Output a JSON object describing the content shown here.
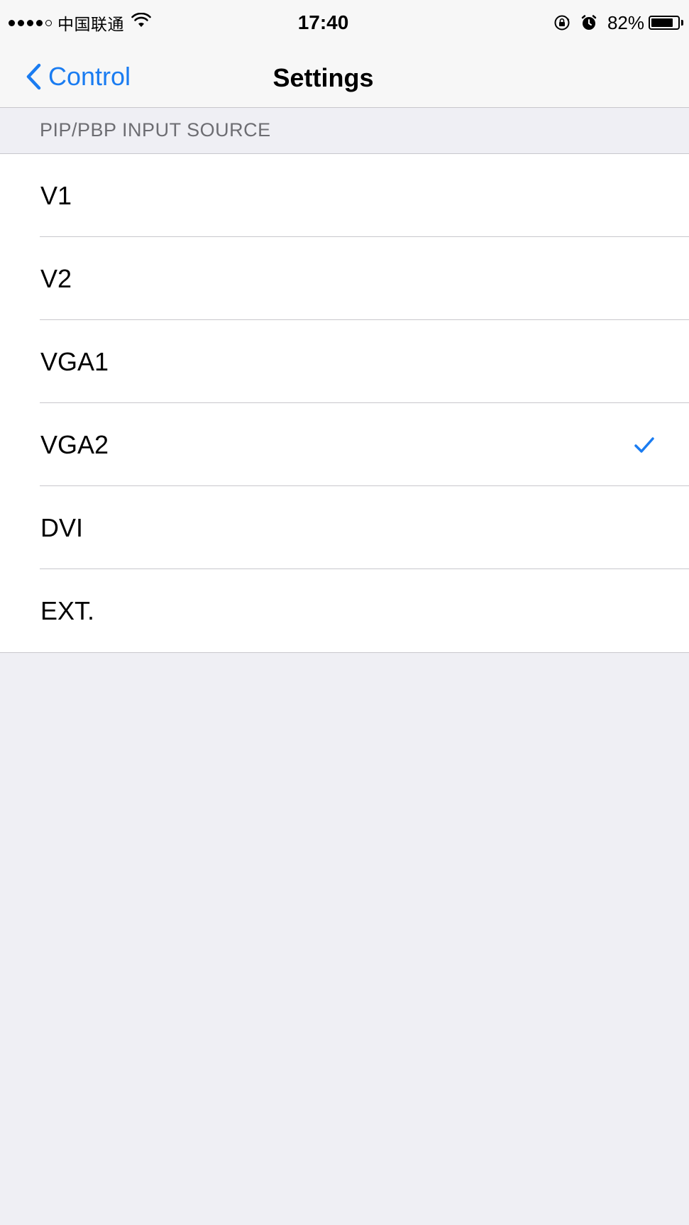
{
  "status_bar": {
    "carrier": "中国联通",
    "time": "17:40",
    "battery_percent": "82%",
    "battery_level": 0.82,
    "icons": [
      "signal-dots-icon",
      "wifi-icon",
      "rotation-lock-icon",
      "alarm-icon",
      "battery-icon"
    ]
  },
  "nav": {
    "back_label": "Control",
    "title": "Settings"
  },
  "section": {
    "header": "PIP/PBP INPUT SOURCE"
  },
  "options": [
    {
      "label": "V1",
      "selected": false
    },
    {
      "label": "V2",
      "selected": false
    },
    {
      "label": "VGA1",
      "selected": false
    },
    {
      "label": "VGA2",
      "selected": true
    },
    {
      "label": "DVI",
      "selected": false
    },
    {
      "label": "EXT.",
      "selected": false
    }
  ],
  "colors": {
    "accent": "#1a7cf1",
    "background": "#efeff4",
    "separator": "#c8c7cc",
    "section_header_text": "#6d6d72"
  }
}
